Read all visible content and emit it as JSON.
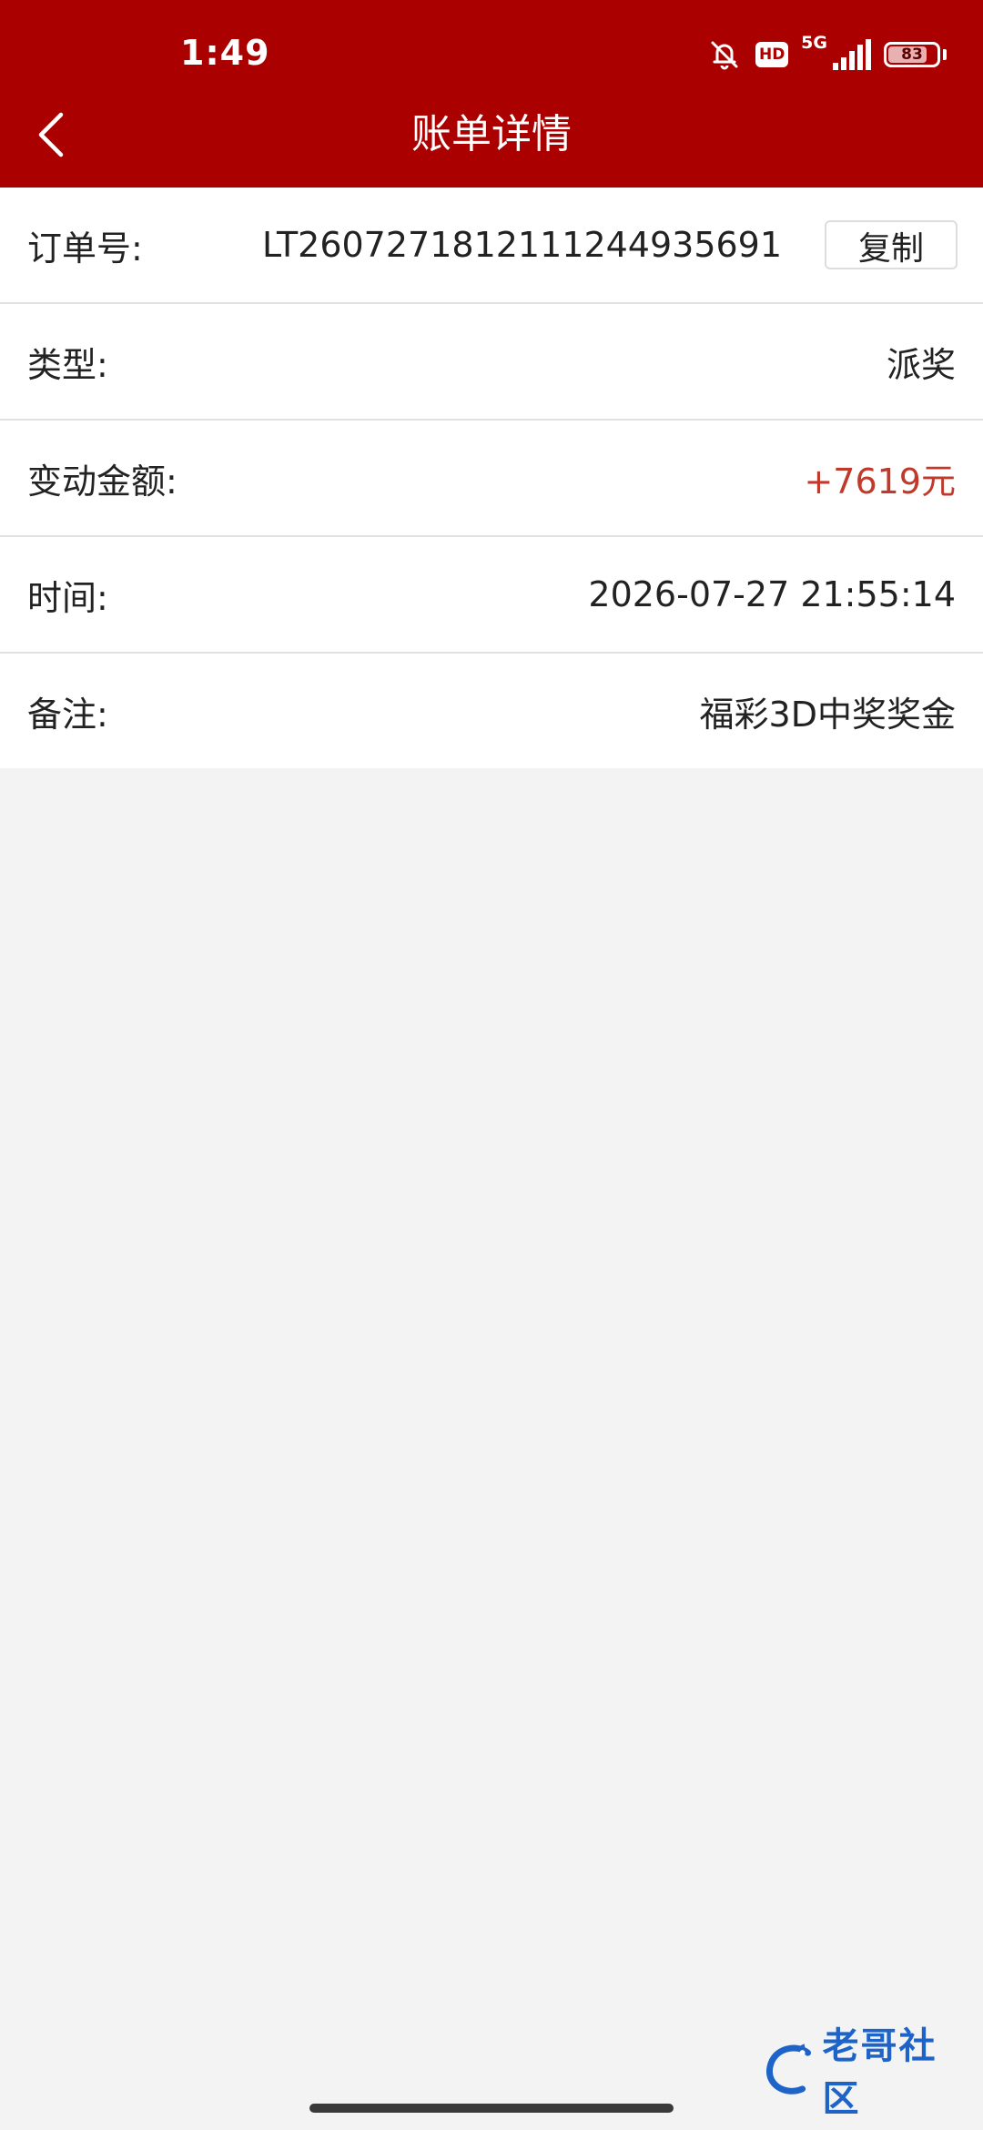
{
  "status_bar": {
    "time": "1:49",
    "hd_label": "HD",
    "network_label": "5G",
    "battery_level": "83",
    "battery_fraction": 0.83
  },
  "header": {
    "title": "账单详情",
    "back_icon": "chevron-left-icon"
  },
  "details": {
    "order": {
      "label": "订单号:",
      "value": "LT2607271812111244935691",
      "copy_label": "复制"
    },
    "type": {
      "label": "类型:",
      "value": "派奖"
    },
    "amount": {
      "label": "变动金额:",
      "value": "+7619元"
    },
    "time": {
      "label": "时间:",
      "value": "2026-07-27 21:55:14"
    },
    "remark": {
      "label": "备注:",
      "value": "福彩3D中奖奖金"
    }
  },
  "watermark": {
    "text": "老哥社区"
  },
  "colors": {
    "header": "#ab0000",
    "amount": "#c0392b",
    "background": "#f3f3f3"
  }
}
